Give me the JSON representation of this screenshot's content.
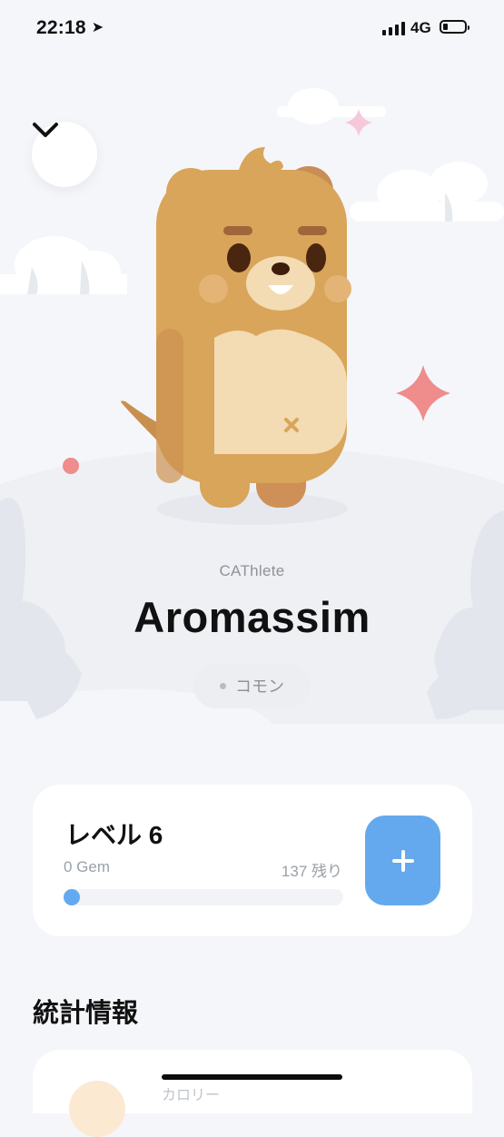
{
  "status_bar": {
    "time": "22:18",
    "network": "4G"
  },
  "pet": {
    "species": "CAThlete",
    "name": "Aromassim",
    "rarity": "コモン"
  },
  "level_card": {
    "title": "レベル 6",
    "gem": "0 Gem",
    "remaining": "137 残り",
    "progress_fraction": 0.02,
    "accent": "#64a9ee"
  },
  "stats": {
    "heading": "統計情報",
    "first_item_label": "カロリー"
  },
  "icons": [
    "location-arrow-icon",
    "signal-icon",
    "battery-icon",
    "chevron-down-icon",
    "plus-icon"
  ],
  "colors": {
    "background": "#f5f6fa",
    "card": "#ffffff",
    "bear_body": "#d8a55a",
    "sparkle": "#ef8c8c"
  }
}
